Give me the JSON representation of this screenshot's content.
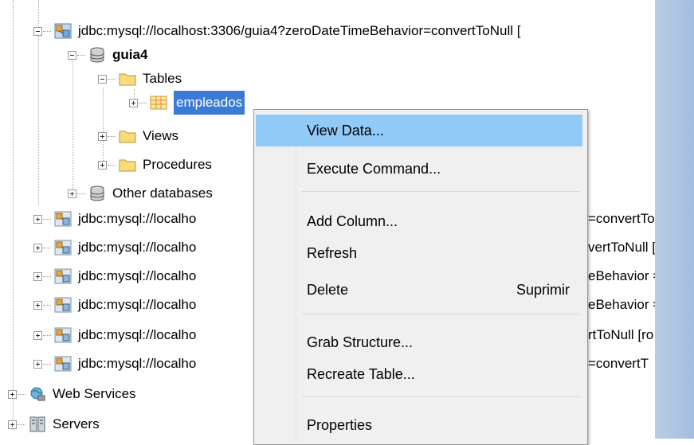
{
  "tree": {
    "root_connection": "jdbc:mysql://localhost:3306/guia4?zeroDateTimeBehavior=convertToNull [",
    "schema": "guia4",
    "tables_folder": "Tables",
    "selected_table": "empleados",
    "views_folder": "Views",
    "procedures_folder": "Procedures",
    "other_databases": "Other databases",
    "connections": [
      {
        "left": "jdbc:mysql://localho",
        "right": "=convertTo"
      },
      {
        "left": "jdbc:mysql://localho",
        "right": "vertToNull ["
      },
      {
        "left": "jdbc:mysql://localho",
        "right": "eBehavior ="
      },
      {
        "left": "jdbc:mysql://localho",
        "right": "eBehavior ="
      },
      {
        "left": "jdbc:mysql://localho",
        "right": "rtToNull [ro"
      },
      {
        "left": "jdbc:mysql://localho",
        "right": "=convertT"
      }
    ],
    "web_services": "Web Services",
    "servers": "Servers"
  },
  "context_menu": {
    "view_data": "View Data...",
    "execute_command": "Execute Command...",
    "add_column": "Add Column...",
    "refresh": "Refresh",
    "delete": "Delete",
    "delete_shortcut": "Suprimir",
    "grab_structure": "Grab Structure...",
    "recreate_table": "Recreate Table...",
    "properties": "Properties"
  },
  "colors": {
    "selection": "#3a7bd5",
    "menu_hover": "#91c9f7",
    "menu_bg": "#f0f0f0"
  }
}
